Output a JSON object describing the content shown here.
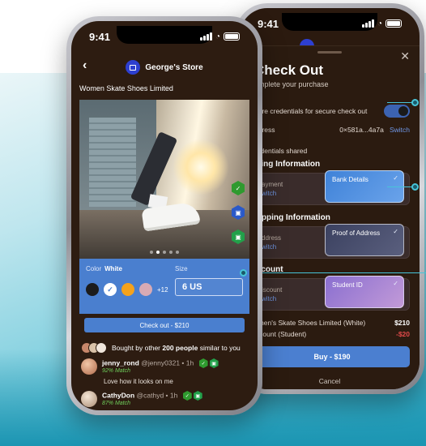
{
  "colors": {
    "accent": "#4a7fcf",
    "link": "#6f97e6",
    "background_dark": "#2b1b10",
    "match_green": "#6fcf5b",
    "discount_red": "#e24a4a",
    "callout": "#47c4d8"
  },
  "status": {
    "time": "9:41",
    "icons": [
      "signal-icon",
      "wifi-icon",
      "battery-icon"
    ]
  },
  "checkout": {
    "title": "Check Out",
    "subtitle": "omplete your purchase",
    "share_label": "hare credentials for secure check out",
    "share_enabled": true,
    "address_label": "ddress",
    "address_value": "0×581a...4a7a",
    "switch_label": "Switch",
    "credentials_shared": "redentials shared",
    "billing": {
      "heading": "illing Information",
      "field_label": "ayment",
      "switch_label": "witch",
      "card_label": "Bank Details"
    },
    "shipping": {
      "heading": "hipping Information",
      "field_label": "ddress",
      "switch_label": "witch",
      "card_label": "Proof of Address"
    },
    "discount": {
      "heading": "iscount",
      "field_label": "iscount",
      "switch_label": "witch",
      "card_label": "Student ID"
    },
    "line_item_label": "omen's Skate Shoes Limited (White)",
    "line_item_value": "$210",
    "discount_line_label": "iscount (Student)",
    "discount_line_value": "-$20",
    "buy_label": "Buy - $190",
    "cancel_label": "Cancel",
    "close_icon": "close-icon"
  },
  "product": {
    "back_icon": "chevron-left-icon",
    "store_name": "George's Store",
    "title": "Women Skate Shoes Limited",
    "photo_dots": 5,
    "active_dot": 1,
    "badges": [
      "verified-check-icon",
      "store-badge-icon",
      "store-badge-icon"
    ],
    "color_label": "Color",
    "color_value": "White",
    "swatches": [
      "#1c1c1c",
      "#ffffff",
      "#f4a21c",
      "#d8aab4"
    ],
    "selected_swatch": 1,
    "more_colors": "+12",
    "size_label": "Size",
    "size_value": "6 US",
    "checkout_label": "Check out - $210",
    "bought_prefix": "Bought by other",
    "bought_count": "200 people",
    "bought_suffix": "similar to you",
    "reviews": [
      {
        "name": "jenny_rond",
        "handle": "@jenny0321 • 1h",
        "match": "92% Match",
        "avatar": "#c8876a"
      },
      {
        "name": "CathyDon",
        "handle": "@cathyd • 1h",
        "match": "87% Match",
        "avatar": "#d9c2a8"
      }
    ],
    "comment": "Love how it looks on me"
  }
}
